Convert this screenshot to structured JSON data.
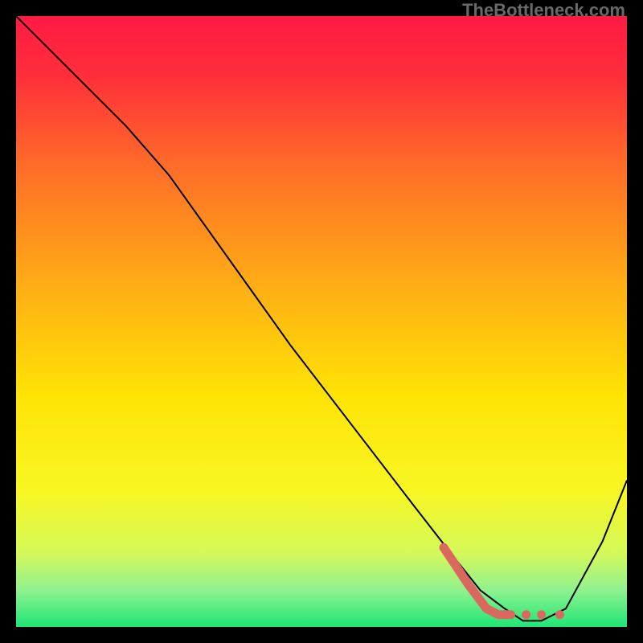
{
  "watermark": "TheBottleneck.com",
  "chart_data": {
    "type": "line",
    "title": "",
    "xlabel": "",
    "ylabel": "",
    "xlim": [
      0,
      100
    ],
    "ylim": [
      0,
      100
    ],
    "grid": false,
    "legend": false,
    "gradient_stops": [
      {
        "offset": 0.0,
        "color": "#ff1a44"
      },
      {
        "offset": 0.1,
        "color": "#ff2f3a"
      },
      {
        "offset": 0.25,
        "color": "#ff6e28"
      },
      {
        "offset": 0.45,
        "color": "#ffb015"
      },
      {
        "offset": 0.62,
        "color": "#ffe305"
      },
      {
        "offset": 0.78,
        "color": "#f7f724"
      },
      {
        "offset": 0.88,
        "color": "#d4f85a"
      },
      {
        "offset": 0.94,
        "color": "#8ff28f"
      },
      {
        "offset": 1.0,
        "color": "#1ee676"
      }
    ],
    "series": [
      {
        "name": "bottleneck-curve",
        "color": "#000000",
        "width": 2,
        "x": [
          0,
          8,
          18,
          25,
          35,
          45,
          55,
          65,
          72,
          76,
          80,
          83,
          86,
          90,
          96,
          100
        ],
        "y": [
          100,
          92,
          82,
          74,
          60,
          46,
          33,
          20,
          11,
          6,
          3,
          1,
          1,
          3,
          14,
          24
        ]
      },
      {
        "name": "highlight-segment",
        "color": "#d9695f",
        "width": 11,
        "cap": "round",
        "x": [
          70,
          74,
          77,
          79,
          81
        ],
        "y": [
          13,
          7,
          3,
          2,
          2
        ]
      }
    ],
    "highlight_dots": {
      "color": "#d9695f",
      "r": 5.5,
      "points": [
        {
          "x": 83.5,
          "y": 2
        },
        {
          "x": 86.0,
          "y": 2
        },
        {
          "x": 89.0,
          "y": 2
        }
      ]
    }
  }
}
